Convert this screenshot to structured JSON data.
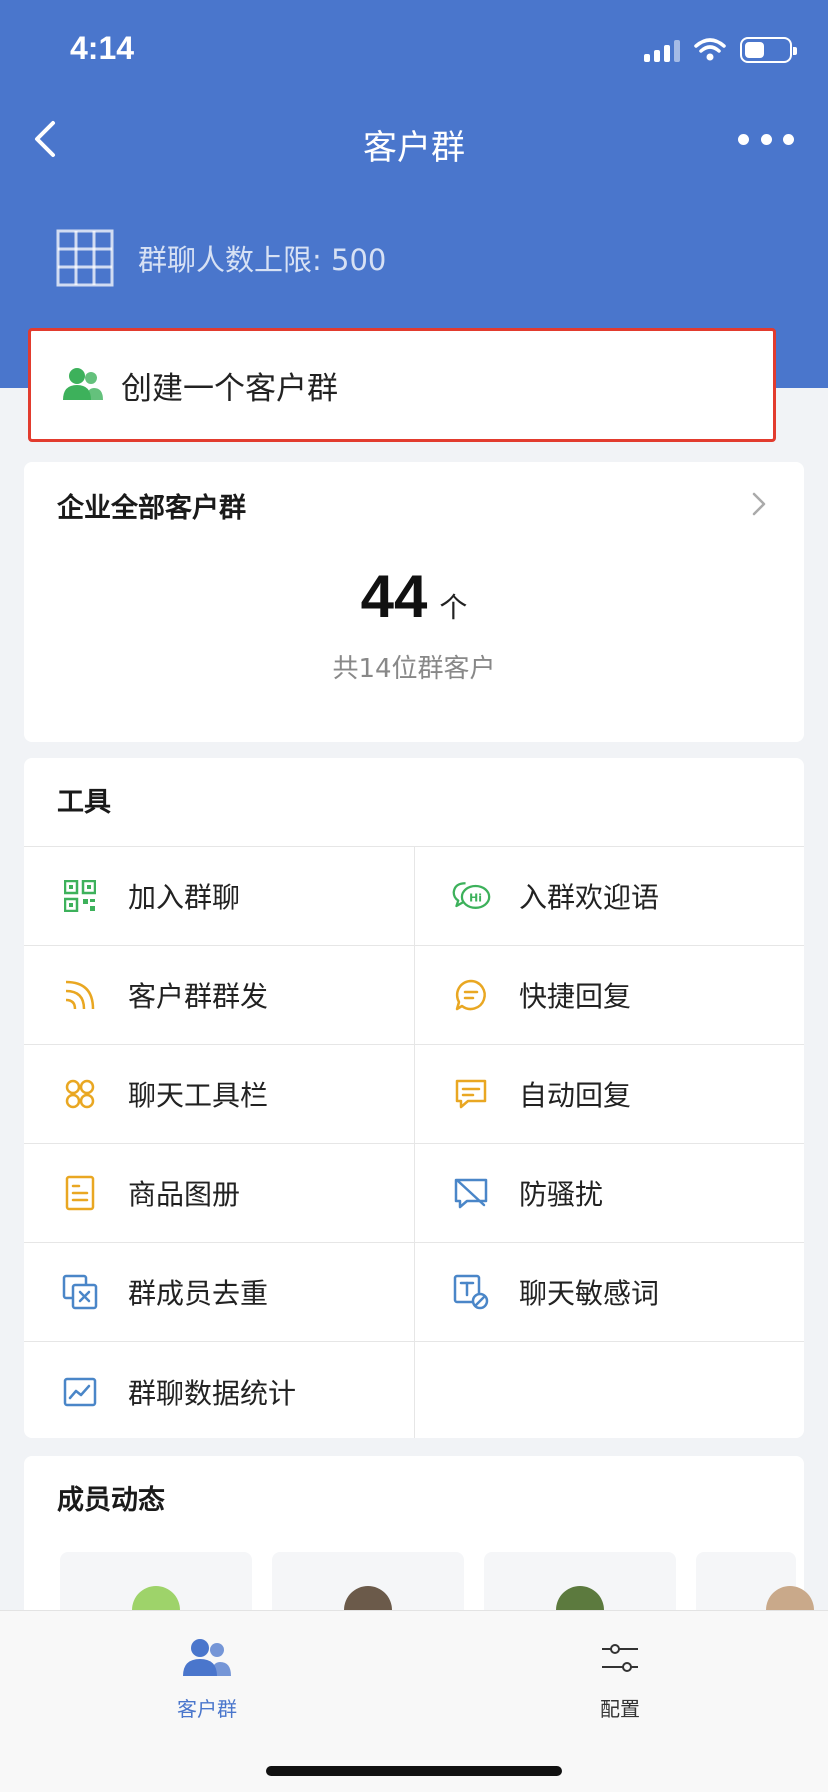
{
  "status_bar": {
    "time": "4:14"
  },
  "nav": {
    "title": "客户群"
  },
  "header": {
    "limit_text": "群聊人数上限: 500"
  },
  "create": {
    "label": "创建一个客户群"
  },
  "all_groups": {
    "title": "企业全部客户群",
    "count": "44",
    "unit": "个",
    "subtitle": "共14位群客户"
  },
  "tools": {
    "title": "工具",
    "items": [
      {
        "label": "加入群聊",
        "icon": "qr-code-icon",
        "color": "#3db15b"
      },
      {
        "label": "入群欢迎语",
        "icon": "hi-chat-icon",
        "color": "#3db15b"
      },
      {
        "label": "客户群群发",
        "icon": "broadcast-icon",
        "color": "#e9a722"
      },
      {
        "label": "快捷回复",
        "icon": "quick-reply-icon",
        "color": "#e9a722"
      },
      {
        "label": "聊天工具栏",
        "icon": "toolbar-icon",
        "color": "#e9a722"
      },
      {
        "label": "自动回复",
        "icon": "auto-reply-icon",
        "color": "#e9a722"
      },
      {
        "label": "商品图册",
        "icon": "catalog-icon",
        "color": "#e9a722"
      },
      {
        "label": "防骚扰",
        "icon": "anti-harass-icon",
        "color": "#4a86c8"
      },
      {
        "label": "群成员去重",
        "icon": "dedupe-icon",
        "color": "#4a86c8"
      },
      {
        "label": "聊天敏感词",
        "icon": "sensitive-word-icon",
        "color": "#4a86c8"
      },
      {
        "label": "群聊数据统计",
        "icon": "stats-icon",
        "color": "#4a86c8"
      }
    ]
  },
  "members": {
    "title": "成员动态"
  },
  "tabbar": {
    "tabs": [
      {
        "label": "客户群",
        "icon": "people-icon",
        "active": true
      },
      {
        "label": "配置",
        "icon": "sliders-icon",
        "active": false
      }
    ]
  },
  "colors": {
    "brand_blue": "#4a76cc",
    "highlight_red": "#e23b2e",
    "green": "#3db15b"
  }
}
